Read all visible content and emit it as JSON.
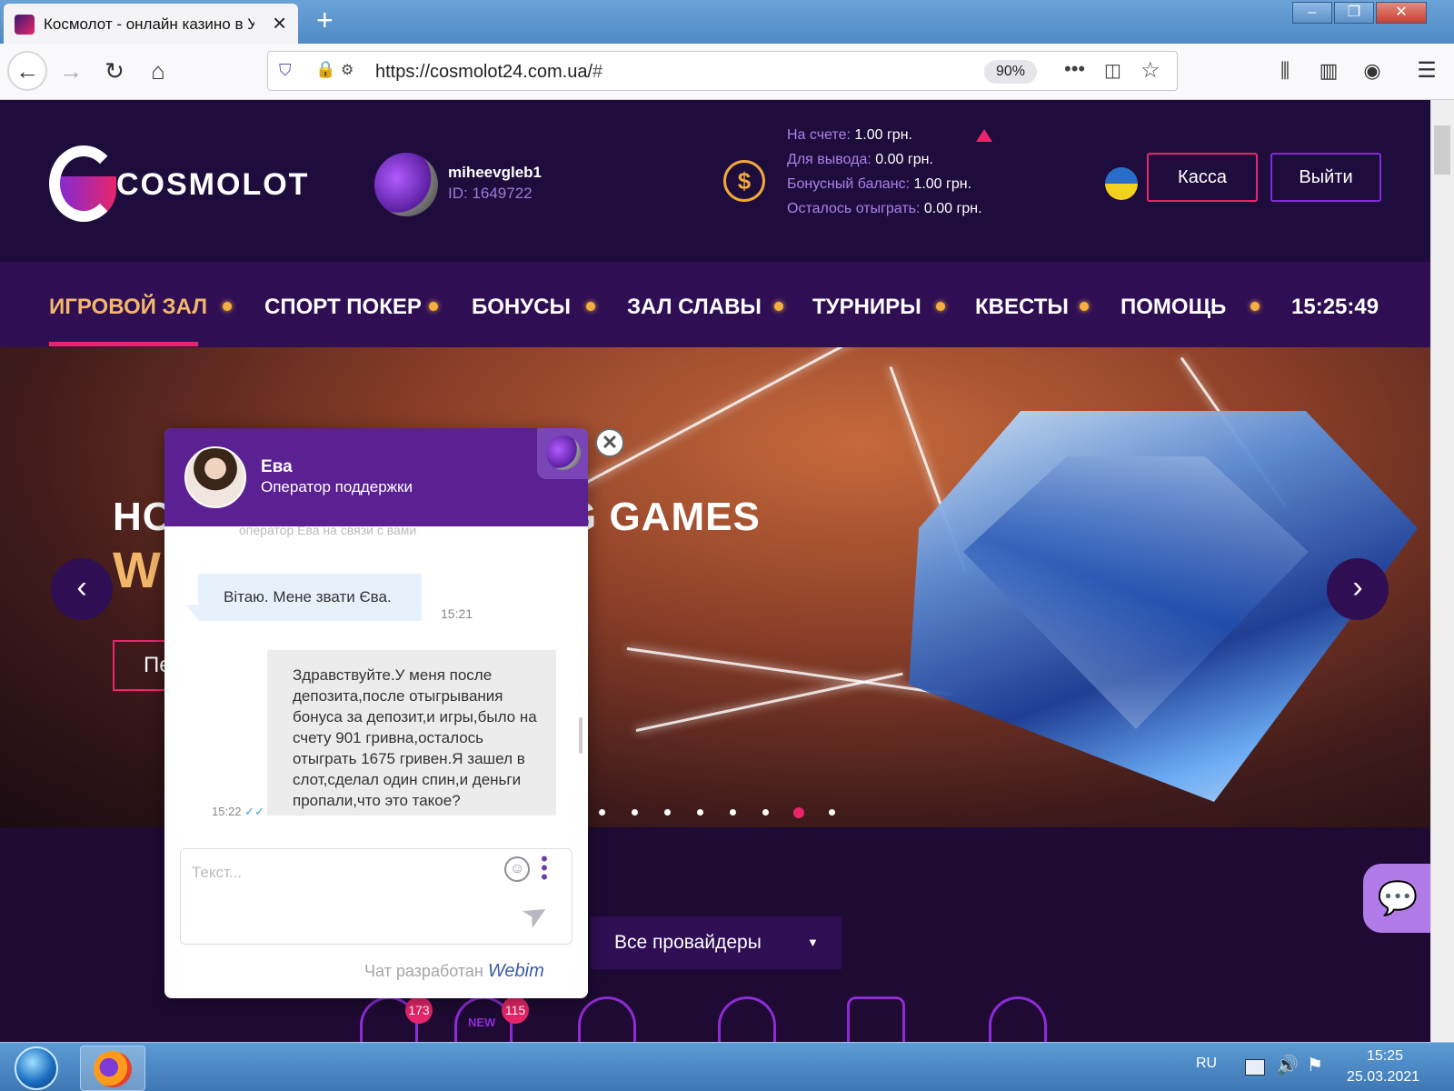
{
  "browser": {
    "tab_title": "Космолот - онлайн казино в Украине",
    "url_host": "https://cosmolot24.com.ua/",
    "url_hash": "#",
    "zoom": "90%"
  },
  "header": {
    "logo_text": "COSMOLOT",
    "username": "miheevgleb1",
    "user_id": "ID: 1649722",
    "balances": [
      {
        "label": "На счете:",
        "value": "1.00 грн."
      },
      {
        "label": "Для вывода:",
        "value": "0.00 грн."
      },
      {
        "label": "Бонусный баланс:",
        "value": "1.00 грн."
      },
      {
        "label": "Осталось отыграть:",
        "value": "0.00 грн."
      }
    ],
    "cashier_label": "Касса",
    "logout_label": "Выйти"
  },
  "nav": {
    "items": [
      "ИГРОВОЙ ЗАЛ",
      "СПОРТ ПОКЕР",
      "БОНУСЫ",
      "ЗАЛ СЛАВЫ",
      "ТУРНИРЫ",
      "КВЕСТЫ",
      "ПОМОЩЬ"
    ],
    "clock": "15:25:49",
    "active_index": 0
  },
  "hero": {
    "title_left": "HO",
    "title_right": "G GAMES",
    "big_letter": "W",
    "button_partial": "Пе",
    "prev_icon": "‹",
    "next_icon": "›",
    "active_slide": 7,
    "slide_count": 8
  },
  "lower": {
    "providers_label": "Все провайдеры",
    "badge_1": "173",
    "badge_2": "115",
    "badge_2_text": "NEW"
  },
  "chat": {
    "operator_name": "Ева",
    "operator_role": "Оператор поддержки",
    "system_note": "оператор Ева на связи с вами",
    "messages": [
      {
        "from": "operator",
        "text": "Вітаю. Мене звати Єва.",
        "time": "15:21"
      },
      {
        "from": "user",
        "text": "Здравствуйте.У меня после депозита,после отыгрывания бонуса за депозит,и игры,было на счету 901 гривна,осталось отыграть 1675 гривен.Я зашел в слот,сделал один спин,и деньги пропали,что это такое?",
        "time": "15:22"
      }
    ],
    "input_placeholder": "Текст...",
    "powered_by": "Чат разработан",
    "powered_brand": "Webim"
  },
  "taskbar": {
    "lang": "RU",
    "time": "15:25",
    "date": "25.03.2021"
  },
  "colors": {
    "accent": "#e8256a",
    "purple": "#5b2193",
    "nav_active": "#f3b76a",
    "header_bg": "#1e0d3c"
  }
}
